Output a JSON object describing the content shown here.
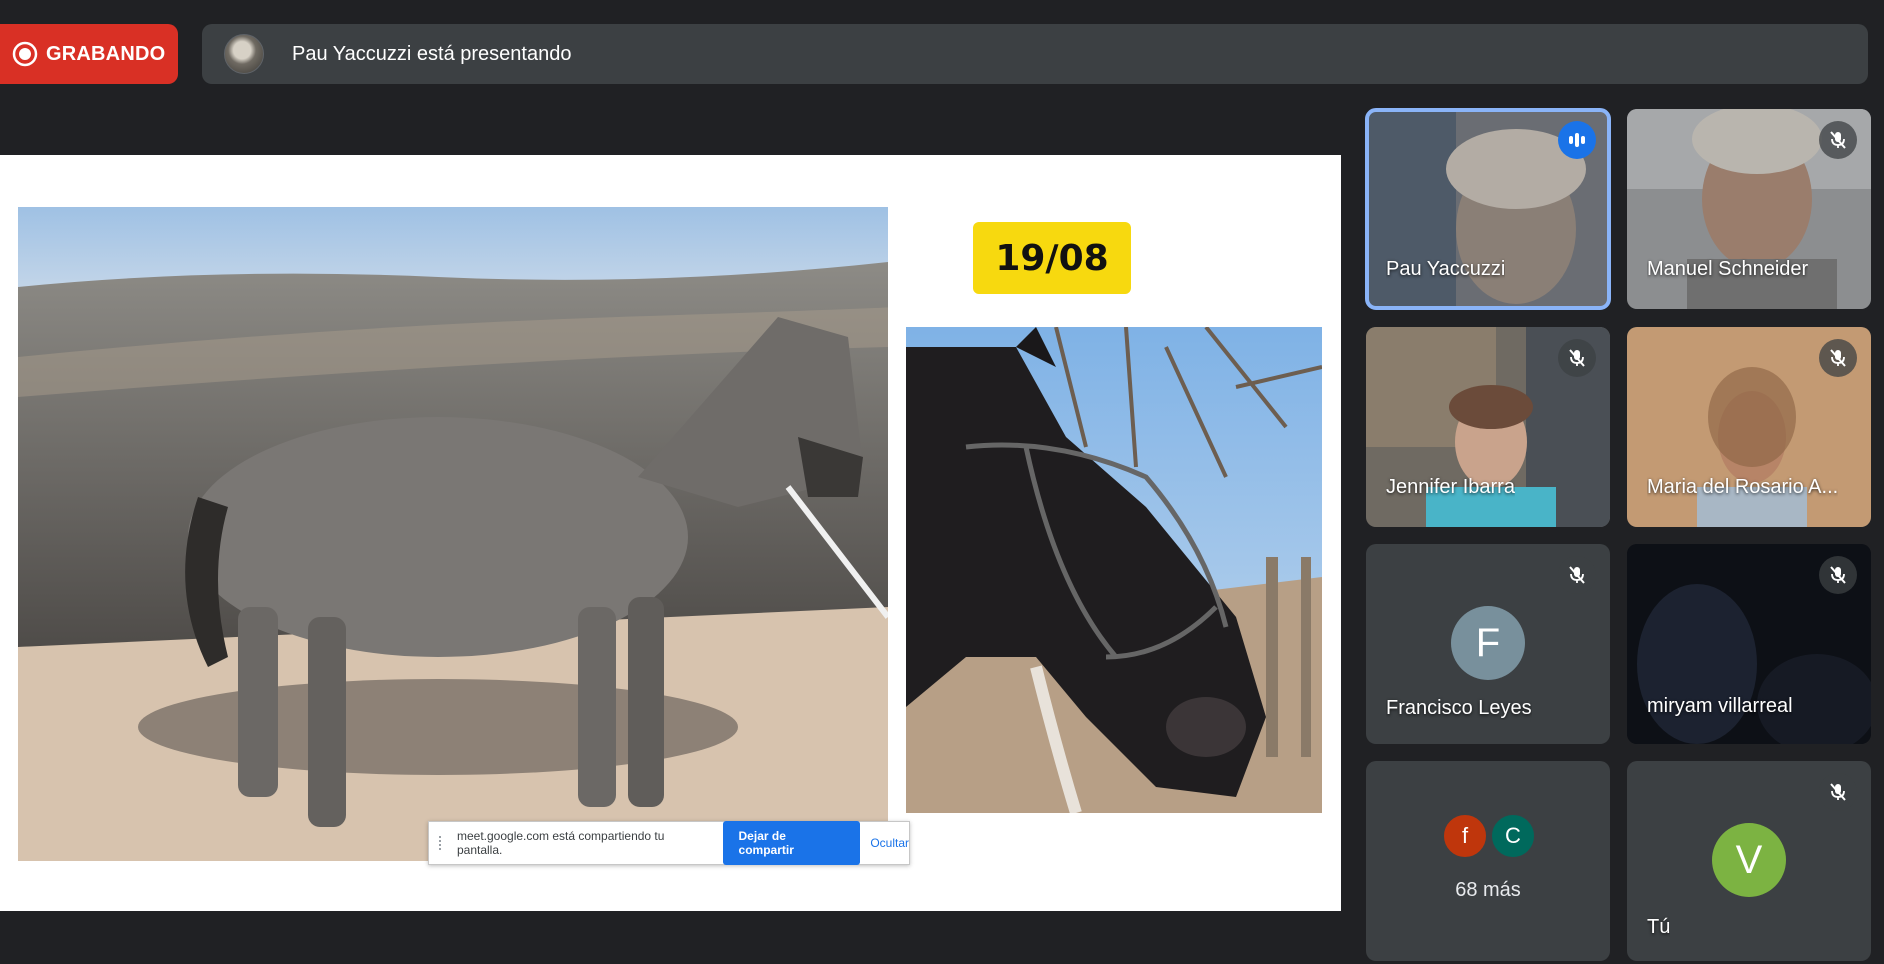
{
  "recording": {
    "label": "GRABANDO",
    "color": "#d93025"
  },
  "presenter_banner": {
    "text": "Pau Yaccuzzi está presentando"
  },
  "shared_screen": {
    "date_label": "19/08",
    "share_notice": {
      "message": "meet.google.com está compartiendo tu pantalla.",
      "stop_label": "Dejar de compartir",
      "hide_label": "Ocultar"
    }
  },
  "participants": [
    {
      "name": "Pau Yaccuzzi",
      "speaking": true
    },
    {
      "name": "Manuel Schneider",
      "muted": true
    },
    {
      "name": "Jennifer Ibarra",
      "muted": true
    },
    {
      "name": "Maria del Rosario A...",
      "muted": true
    },
    {
      "name": "Francisco Leyes",
      "initial": "F",
      "muted": true,
      "avatar_color": "#78909c"
    },
    {
      "name": "miryam villarreal",
      "muted": true
    },
    {
      "more_label": "68 más",
      "avatars": [
        {
          "initial": "f",
          "color": "#bf360c"
        },
        {
          "initial": "C",
          "color": "#00695c"
        }
      ]
    },
    {
      "name": "Tú",
      "initial": "V",
      "muted": true,
      "avatar_color": "#7cb342"
    }
  ],
  "colors": {
    "background": "#202124",
    "tile": "#3c4043",
    "accent": "#1a73e8",
    "active_outline": "#8ab4f8"
  }
}
